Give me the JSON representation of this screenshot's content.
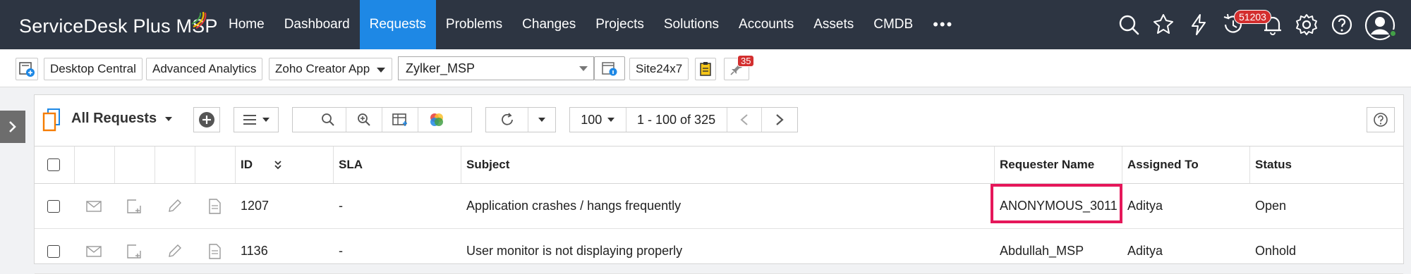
{
  "brand": {
    "name": "ServiceDesk Plus MSP"
  },
  "nav": {
    "items": [
      {
        "label": "Home"
      },
      {
        "label": "Dashboard"
      },
      {
        "label": "Requests"
      },
      {
        "label": "Problems"
      },
      {
        "label": "Changes"
      },
      {
        "label": "Projects"
      },
      {
        "label": "Solutions"
      },
      {
        "label": "Accounts"
      },
      {
        "label": "Assets"
      },
      {
        "label": "CMDB"
      }
    ],
    "active": "Requests",
    "more_label": "•••",
    "notification_count": "51203"
  },
  "subbar": {
    "buttons": [
      "Desktop Central",
      "Advanced Analytics"
    ],
    "zoho_creator": "Zoho Creator App",
    "account_select": "Zylker_MSP",
    "site24x7": "Site24x7",
    "pin_badge": "35"
  },
  "toolbar": {
    "view_title": "All Requests",
    "page_size": "100",
    "page_range": "1 - 100 of 325"
  },
  "table": {
    "headers": {
      "id": "ID",
      "sla": "SLA",
      "subject": "Subject",
      "requester": "Requester Name",
      "assigned": "Assigned To",
      "status": "Status"
    },
    "rows": [
      {
        "id": "1207",
        "sla": "-",
        "subject": "Application crashes / hangs frequently",
        "requester": "ANONYMOUS_3011",
        "assigned": "Aditya",
        "status": "Open"
      },
      {
        "id": "1136",
        "sla": "-",
        "subject": "User monitor is not displaying properly",
        "requester": "Abdullah_MSP",
        "assigned": "Aditya",
        "status": "Onhold"
      }
    ]
  },
  "colors": {
    "nav_bg": "#2d3542",
    "active_tab": "#1e88e5",
    "highlight": "#e5175a",
    "badge": "#d32f2f"
  }
}
